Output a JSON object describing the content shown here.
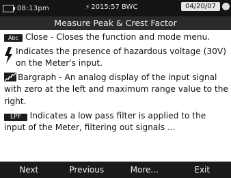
{
  "status_bar": {
    "time": "08:13pm",
    "center_text": "2015:57 BWC",
    "date": "04/20/07",
    "icons": {
      "battery": "battery-icon",
      "bolt": "bolt-icon",
      "circle": "status-circle-icon"
    }
  },
  "title": "Measure Peak & Crest Factor",
  "help_items": [
    {
      "key": "Abc",
      "text": "Close - Closes the function and mode menu."
    },
    {
      "icon": "lightning-bolt-icon",
      "text": "Indicates the presence of hazardous voltage (30V) on the Meter's input."
    },
    {
      "icon": "bargraph-icon",
      "text": "Bargraph - An analog display of the input signal with zero at the left and maximum range value to the right."
    },
    {
      "key": "LPF",
      "text": "Indicates a low pass filter is applied to the input of the Meter, filtering out signals ..."
    }
  ],
  "softkeys": [
    "Next",
    "Previous",
    "More...",
    "Exit"
  ],
  "colors": {
    "background": "#ffffff",
    "bars": "#1a1a1a",
    "text": "#101010"
  }
}
